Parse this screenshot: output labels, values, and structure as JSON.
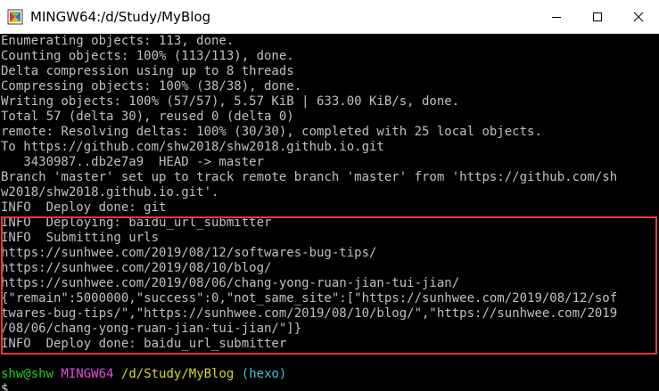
{
  "window": {
    "title": "MINGW64:/d/Study/MyBlog",
    "icon": "mingw-terminal-icon",
    "controls": [
      "minimize-icon",
      "maximize-icon",
      "close-icon"
    ]
  },
  "output_lines": [
    "Enumerating objects: 113, done.",
    "Counting objects: 100% (113/113), done.",
    "Delta compression using up to 8 threads",
    "Compressing objects: 100% (38/38), done.",
    "Writing objects: 100% (57/57), 5.57 KiB | 633.00 KiB/s, done.",
    "Total 57 (delta 30), reused 0 (delta 0)",
    "remote: Resolving deltas: 100% (30/30), completed with 25 local objects.",
    "To https://github.com/shw2018/shw2018.github.io.git",
    "   3430987..db2e7a9  HEAD -> master",
    "Branch 'master' set up to track remote branch 'master' from 'https://github.com/sh",
    "w2018/shw2018.github.io.git'.",
    "INFO  Deploy done: git"
  ],
  "highlighted_lines": [
    "INFO  Deploying: baidu_url_submitter",
    "INFO  Submitting urls",
    "https://sunhwee.com/2019/08/12/softwares-bug-tips/",
    "https://sunhwee.com/2019/08/10/blog/",
    "https://sunhwee.com/2019/08/06/chang-yong-ruan-jian-tui-jian/",
    "{\"remain\":5000000,\"success\":0,\"not_same_site\":[\"https://sunhwee.com/2019/08/12/sof",
    "twares-bug-tips/\",\"https://sunhwee.com/2019/08/10/blog/\",\"https://sunhwee.com/2019",
    "/08/06/chang-yong-ruan-jian-tui-jian/\"]}",
    "INFO  Deploy done: baidu_url_submitter"
  ],
  "prompt": {
    "user_host": "shw@shw",
    "system": "MINGW64",
    "path": "/d/Study/MyBlog",
    "branch": "(hexo)",
    "symbol": "$"
  },
  "colors": {
    "highlight_border": "#e8393b",
    "prompt_user": "#1fd11f",
    "prompt_system": "#e14fe1",
    "prompt_path": "#d8d82b",
    "prompt_branch": "#3ec5d8"
  }
}
